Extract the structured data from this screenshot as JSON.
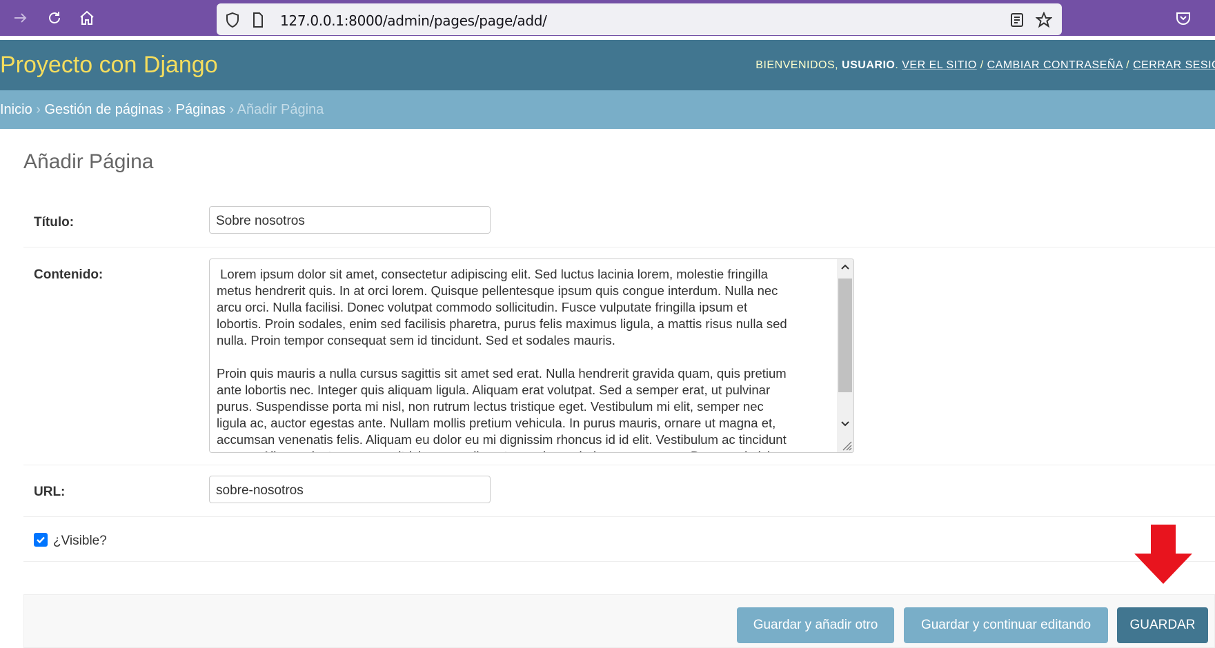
{
  "browser": {
    "url": "127.0.0.1:8000/admin/pages/page/add/",
    "icons": [
      "forward-arrow-icon",
      "reload-icon",
      "home-icon",
      "shield-icon",
      "page-icon",
      "reader-view-icon",
      "bookmark-star-icon",
      "pocket-icon"
    ]
  },
  "header": {
    "branding": "Proyecto con Django",
    "welcome": "BIENVENIDOS,",
    "username": "USUARIO",
    "view_site": "VER EL SITIO",
    "change_password": "CAMBIAR CONTRASEÑA",
    "logout": "CERRAR SESIÓ",
    "separator": "/"
  },
  "breadcrumbs": {
    "items": [
      "Inicio",
      "Gestión de páginas",
      "Páginas",
      "Añadir Página"
    ],
    "separator": "›"
  },
  "page": {
    "title": "Añadir Página"
  },
  "form": {
    "titulo_label": "Título:",
    "titulo_value": "Sobre nosotros",
    "contenido_label": "Contenido:",
    "contenido_lines": [
      " Lorem ipsum dolor sit amet, consectetur adipiscing elit. Sed luctus lacinia lorem, molestie fringilla",
      "metus hendrerit quis. In at orci lorem. Quisque pellentesque ipsum quis congue interdum. Nulla nec",
      "arcu orci. Nulla facilisi. Donec volutpat commodo sollicitudin. Fusce vulputate fringilla ipsum et",
      "lobortis. Proin sodales, enim sed facilisis pharetra, purus felis maximus ligula, a mattis risus nulla sed",
      "nulla. Proin tempor consequat sem id tincidunt. Sed et sodales mauris.",
      "",
      "Proin quis mauris a nulla cursus sagittis sit amet sed erat. Nulla hendrerit gravida quam, quis pretium",
      "ante lobortis nec. Integer quis aliquam ligula. Aliquam erat volutpat. Sed a semper erat, ut pulvinar",
      "purus. Suspendisse porta mi nisl, non rutrum lectus tristique eget. Vestibulum mi elit, semper nec",
      "ligula ac, auctor egestas ante. Nullam mollis pretium vehicula. In purus mauris, ornare ut magna et,",
      "accumsan venenatis felis. Aliquam eu dolor eu mi dignissim rhoncus id id elit. Vestibulum ac tincidunt",
      "magna. Aliquam lectus neque, ultricies a condimentum quis, scelerisque nec purus. Donec vel nisi"
    ],
    "url_label": "URL:",
    "url_value": "sobre-nosotros",
    "visible_label": "¿Visible?",
    "visible_checked": true
  },
  "buttons": {
    "save_add_another": "Guardar y añadir otro",
    "save_continue": "Guardar y continuar editando",
    "save": "GUARDAR"
  },
  "colors": {
    "browser_toolbar": "#7350a5",
    "header": "#417690",
    "branding": "#f5dd5d",
    "breadcrumbs": "#79aec8",
    "annotation_arrow": "#e8141e"
  }
}
